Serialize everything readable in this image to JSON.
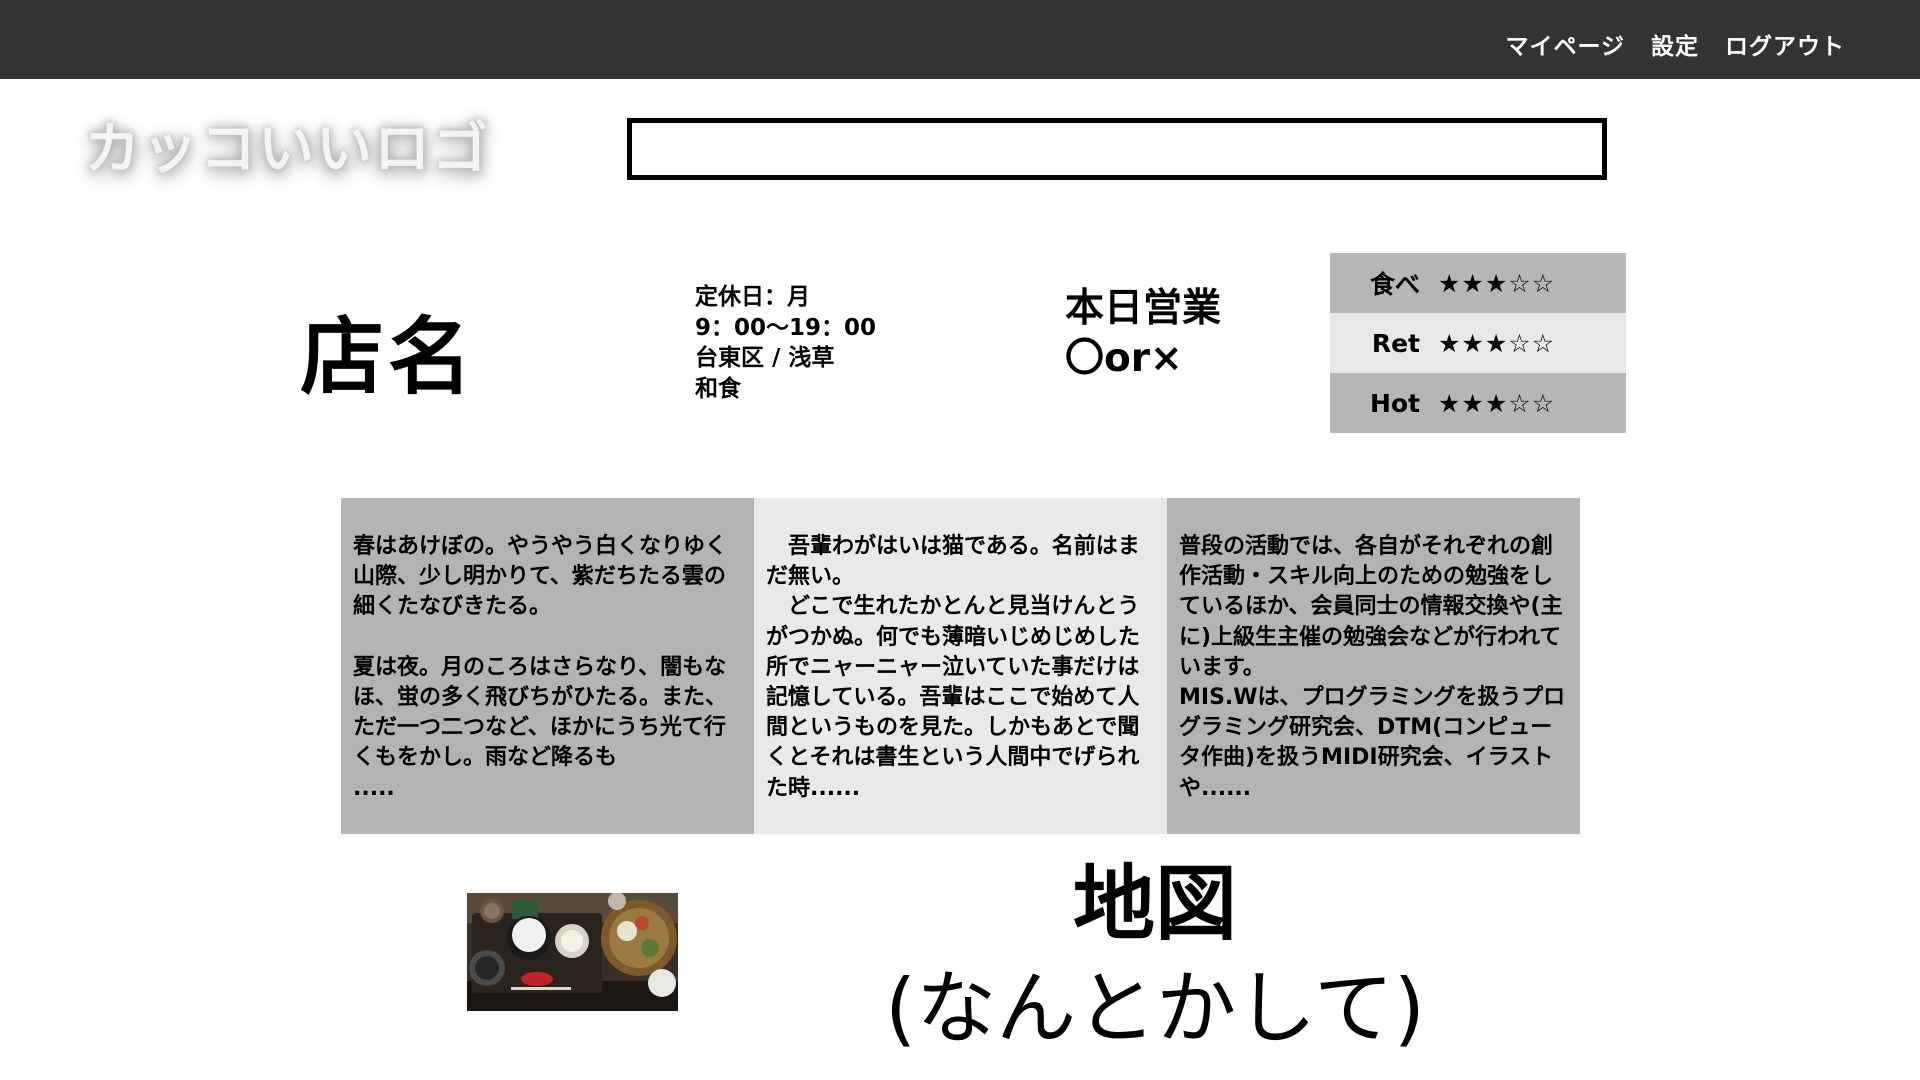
{
  "header": {
    "nav": [
      {
        "label": "マイページ"
      },
      {
        "label": "設定"
      },
      {
        "label": "ログアウト"
      }
    ]
  },
  "logo": {
    "text": "カッコいいロゴ"
  },
  "search": {
    "value": "",
    "placeholder": ""
  },
  "shop": {
    "name": "店名",
    "info": [
      "定休日：月",
      "9：00〜19：00",
      "台東区 / 浅草",
      "和食"
    ],
    "today_label": "本日営業",
    "today_value": "〇or×"
  },
  "ratings": [
    {
      "label": "食べ",
      "stars": "★★★☆☆",
      "value": 3,
      "max": 5
    },
    {
      "label": "Ret",
      "stars": "★★★☆☆",
      "value": 3,
      "max": 5
    },
    {
      "label": "Hot",
      "stars": "★★★☆☆",
      "value": 3,
      "max": 5
    }
  ],
  "columns": [
    {
      "text": "春はあけぼの。やうやう白くなりゆく山際、少し明かりて、紫だちたる雲の細くたなびきたる。\n\n夏は夜。月のころはさらなり、闇もなほ、蛍の多く飛びちがひたる。また、ただ一つ二つなど、ほかにうち光て行くもをかし。雨など降るも\n....."
    },
    {
      "text": "　吾輩わがはいは猫である。名前はまだ無い。\n　どこで生れたかとんと見当けんとうがつかぬ。何でも薄暗いじめじめした所でニャーニャー泣いていた事だけは記憶している。吾輩はここで始めて人間というものを見た。しかもあとで聞くとそれは書生という人間中でげられた時......"
    },
    {
      "text": "普段の活動では、各自がそれぞれの創作活動・スキル向上のための勉強をしているほか、会員同士の情報交換や(主に)上級生主催の勉強会などが行われています。\nMIS.Wは、プログラミングを扱うプログラミング研究会、DTM(コンピュータ作曲)を扱うMIDI研究会、イラストや......"
    }
  ],
  "map": {
    "title": "地図",
    "subtitle": "(なんとかして)"
  },
  "colors": {
    "topbar": "#333333",
    "gray_panel": "#b3b3b3",
    "light_panel": "#eae9e7"
  }
}
